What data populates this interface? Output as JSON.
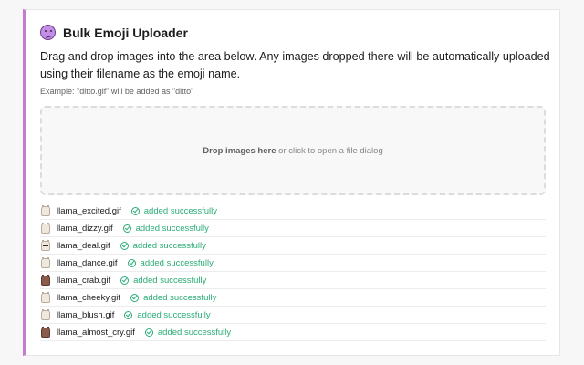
{
  "colors": {
    "accent_border": "#c67ad1",
    "success": "#2bac76"
  },
  "header": {
    "icon": "purple-emoji-face-icon",
    "title": "Bulk Emoji Uploader"
  },
  "description": "Drag and drop images into the area below. Any images dropped there will be automatically uploaded using their filename as the emoji name.",
  "example": "Example: \"ditto.gif\" will be added as \"ditto\"",
  "dropzone": {
    "bold_text": "Drop images here",
    "rest_text": " or click to open a file dialog"
  },
  "uploads": [
    {
      "filename": "llama_excited.gif",
      "status": "added successfully",
      "thumb": "light"
    },
    {
      "filename": "llama_dizzy.gif",
      "status": "added successfully",
      "thumb": "light"
    },
    {
      "filename": "llama_deal.gif",
      "status": "added successfully",
      "thumb": "glasses"
    },
    {
      "filename": "llama_dance.gif",
      "status": "added successfully",
      "thumb": "light"
    },
    {
      "filename": "llama_crab.gif",
      "status": "added successfully",
      "thumb": "dark"
    },
    {
      "filename": "llama_cheeky.gif",
      "status": "added successfully",
      "thumb": "light"
    },
    {
      "filename": "llama_blush.gif",
      "status": "added successfully",
      "thumb": "light"
    },
    {
      "filename": "llama_almost_cry.gif",
      "status": "added successfully",
      "thumb": "dark"
    }
  ]
}
